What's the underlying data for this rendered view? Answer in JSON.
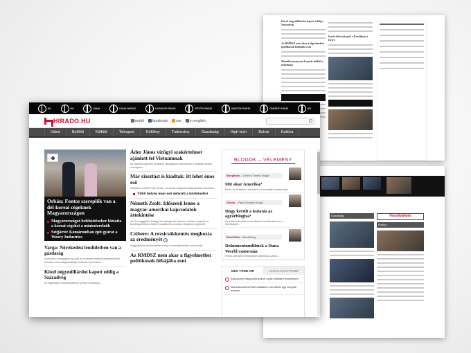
{
  "brand": {
    "logo_text": "HIRADO.HU",
    "accent": "#c41230"
  },
  "channels": [
    "M1",
    "M2",
    "DUNA",
    "DUNA WORLD",
    "KOSSUTH RÁDIÓ",
    "PETŐFI RÁDIÓ",
    "BARTÓK RÁDIÓ",
    "ÖNKÉNT RÁDIÓ",
    "M3"
  ],
  "tools": {
    "mobile": "mobil",
    "facebook": "facebook",
    "rss": "rss",
    "english": "in english"
  },
  "nav": [
    "Videó",
    "Belföld",
    "Külföld",
    "Telesport",
    "Kékfény",
    "Tudomány",
    "Gazdaság",
    "High-tech",
    "Bulvár",
    "Kultúra"
  ],
  "hero": {
    "title": "Orbán: Fontos szereplők van a dél-koreai cégeknek Magyarországon",
    "bullets": [
      "Magyarországot befektetésekre biztatta a koreai cégeket a miniszterelnök",
      "Szijjártó: Komáromban épít gyárat a Woory Industries"
    ]
  },
  "left_articles": [
    {
      "title": "Varga: Növekedési lendületben van a gazdaság",
      "lead": "A bővülés önmagában is jóval az emberek életkörülményeit érinti - mondta a nemzetgazdasági miniszter Szolnokon."
    },
    {
      "title": "Közel négymilliárdot kapott eddig a Századvég",
      "lead": "Az alapítvány elnökhelyettese szerint munkájuk..."
    }
  ],
  "mid_articles": [
    {
      "title": "Áder János vízügyi szakértelmet ajánlott fel Vietnamnak",
      "lead": "Az államfő egyebek hivatalos látogatáson tartózkodik a délkelet-ázsiai országban."
    },
    {
      "title": "Már riasztást is kiadtak: itt lehet ónos eső",
      "lead": "A főváros mellett Fejér-keleti- és észak-magyarországi járások érintettek.",
      "sub": "Több helyen ónos eső nehezíti a közlekedést"
    },
    {
      "title": "Németh Zsolt: Időszerű lenne a magyar-amerikai kapcsolatok áttekintése",
      "lead": "Az Országgyűlés külügyi bizottságának fideszes elnöke meghívta a bizottság ülésére André Goodfriend amerikai ideiglenes ügyvivőt."
    },
    {
      "title": "Czibere: A rezsicsökkentés meghozta az eredményét",
      "lead": "Negyedmillióval kevesebb embere veszélyeztetett, mint tavaly."
    },
    {
      "title": "Az RMDSZ nem akar a figyelmetlen politikusok hibájába esni",
      "lead": ""
    }
  ],
  "blog": {
    "header": "BLOGOK – VÉLEMÉNY",
    "items": [
      {
        "author": "Mozgásmi",
        "blog": "Lőrincz Tamás blogja",
        "title": "Mit akar Amerika?",
        "lead": "Rövid- és középtávú szándékai a transzatlanti partnerség?"
      },
      {
        "author": "Gazda",
        "blog": "Papp Gergely blogja",
        "title": "Hogy került a kutatás az agrárblogba?",
        "lead": "Az utóbbi évtizedek során többször lecsillantak azok a lehetőségek..."
      },
      {
        "author": "Skoff Elsa",
        "blog": "Médiablog",
        "title": "Dokumentumfilmek a Duna World csatornán",
        "lead": "Filmek, amelyek érdeklődésre tarthatnak számot..."
      }
    ]
  },
  "tabs": {
    "active": "MÉG TÖBB HÍR",
    "inactive": "LEGOLVASOTTABB",
    "items": [
      "Karácsonyi hagyományokról nyílik kiállítás Keszthelyen",
      "Manhattanbelvetített találatok a rendőrök egy szegedi házban"
    ]
  },
  "bg_articles": [
    "Közel négymilliárdot kapott eddig a Századvég",
    "Az RMDSZ nem akar a figyelmetlen politikusok hibájába esni",
    "Mentőkormányzat-kutatás nélkül a tudomány",
    "Ismét elbocsátanak a Korábban a ferjre",
    "Veszélyjelzés",
    "Kultúra",
    "Gazdaság"
  ]
}
